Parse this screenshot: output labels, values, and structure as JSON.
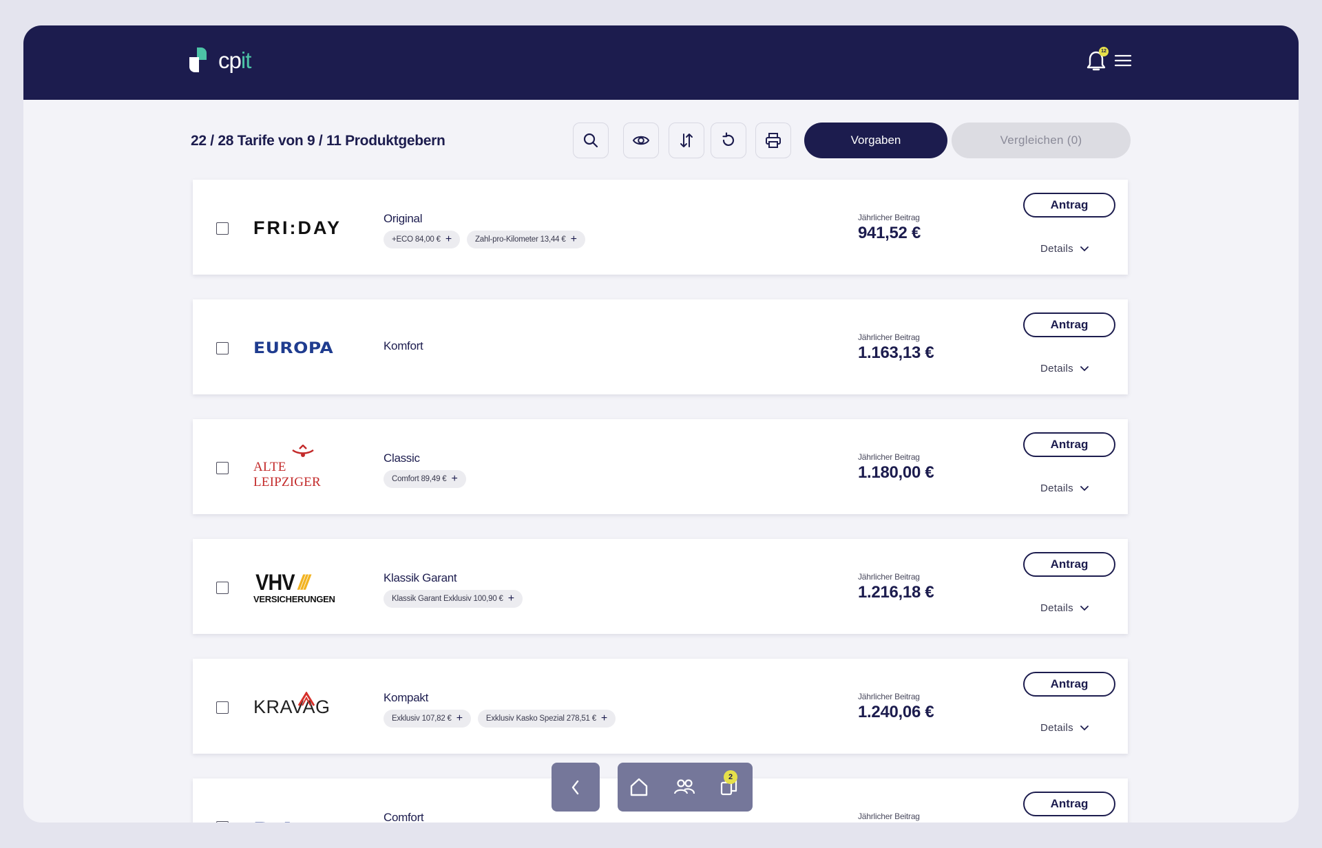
{
  "header": {
    "brand": {
      "main": "cp",
      "accent": "it"
    },
    "notification_count": "12"
  },
  "toolbar": {
    "summary": "22 / 28 Tarife von 9 / 11 Produktgebern",
    "vorgaben_label": "Vorgaben",
    "vergleichen_label": "Vergleichen (0)"
  },
  "common": {
    "price_label": "Jährlicher Beitrag",
    "antrag_label": "Antrag",
    "details_label": "Details"
  },
  "tariffs": [
    {
      "provider_logo": "FRI:DAY",
      "name": "Original",
      "price": "941,52 €",
      "options": [
        "+ECO 84,00 €",
        "Zahl-pro-Kilometer 13,44 €"
      ]
    },
    {
      "provider_logo": "EUROPA",
      "name": "Komfort",
      "price": "1.163,13 €",
      "options": []
    },
    {
      "provider_logo": "ALTE LEIPZIGER",
      "name": "Classic",
      "price": "1.180,00 €",
      "options": [
        "Comfort 89,49 €"
      ]
    },
    {
      "provider_logo": "VHV",
      "provider_logo_sub": "VERSICHERUNGEN",
      "name": "Klassik Garant",
      "price": "1.216,18 €",
      "options": [
        "Klassik Garant Exklusiv 100,90 €"
      ]
    },
    {
      "provider_logo": "KRAVAG",
      "name": "Kompakt",
      "price": "1.240,06 €",
      "options": [
        "Exklusiv 107,82 €",
        "Exklusiv Kasko Spezial 278,51 €"
      ]
    },
    {
      "provider_logo": "DA",
      "name": "Comfort",
      "price": "",
      "options": []
    }
  ],
  "bottom_nav": {
    "badge": "2",
    "icons": [
      "chevron-left-icon",
      "home-icon",
      "users-icon",
      "copy-icon"
    ]
  },
  "colors": {
    "navy": "#1c1c4e",
    "accent_green": "#4cc3a6",
    "badge_yellow": "#e6e04a",
    "nav_gray": "#75779a"
  }
}
